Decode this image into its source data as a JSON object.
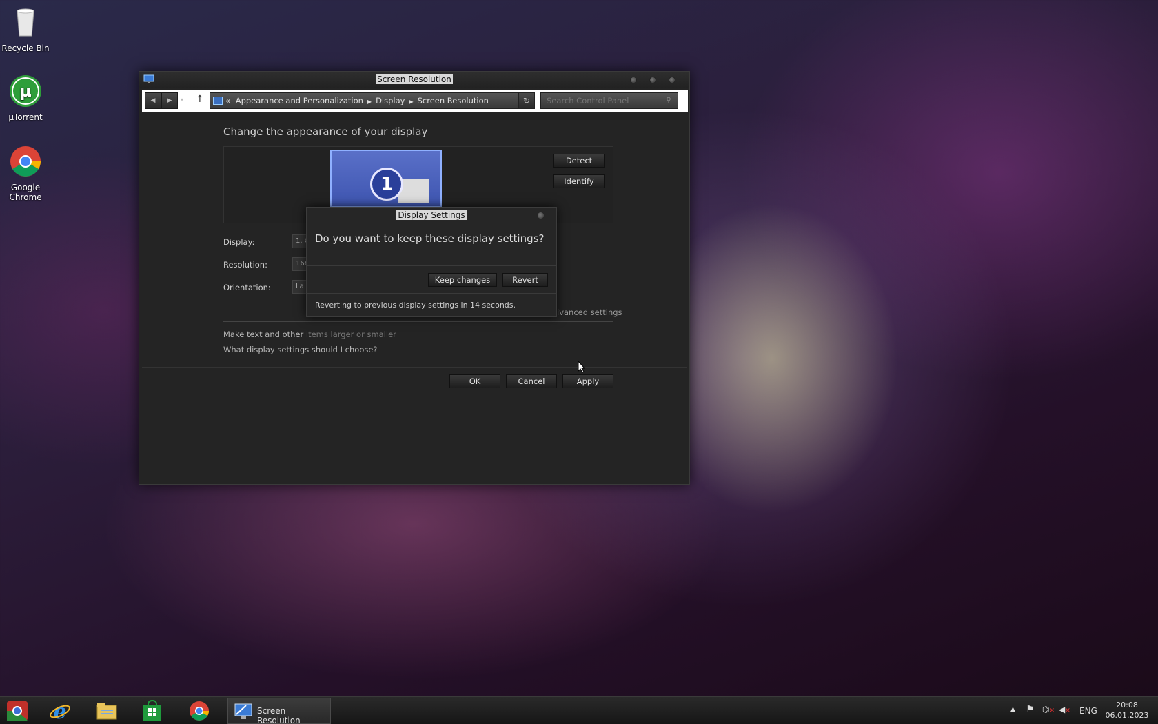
{
  "desktop": {
    "icons": [
      {
        "label": "Recycle Bin"
      },
      {
        "label": "µTorrent"
      },
      {
        "label": "Google\nChrome"
      }
    ]
  },
  "window": {
    "title": "Screen Resolution",
    "address": {
      "prefix": "«",
      "crumbs": [
        "Appearance and Personalization",
        "Display",
        "Screen Resolution"
      ],
      "search_placeholder": "Search Control Panel"
    },
    "heading": "Change the appearance of your display",
    "monitor_number": "1",
    "buttons": {
      "detect": "Detect",
      "identify": "Identify",
      "ok": "OK",
      "cancel": "Cancel",
      "apply": "Apply"
    },
    "fields": {
      "display_label": "Display:",
      "display_value": "1. C",
      "resolution_label": "Resolution:",
      "resolution_value": "168",
      "orientation_label": "Orientation:",
      "orientation_value": "La"
    },
    "advanced_settings": "ivanced settings",
    "links": {
      "text_size_a": "Make text and other ",
      "text_size_b": "items larger or smaller",
      "help": "What display settings should I choose?"
    }
  },
  "dialog": {
    "title": "Display Settings",
    "question": "Do you want to keep these display settings?",
    "keep_label": "Keep changes",
    "revert_label": "Revert",
    "countdown": "Reverting to previous display settings in 14 seconds."
  },
  "taskbar": {
    "active_window": "Screen Resolution",
    "language": "ENG",
    "time": "20:08",
    "date": "06.01.2023"
  }
}
